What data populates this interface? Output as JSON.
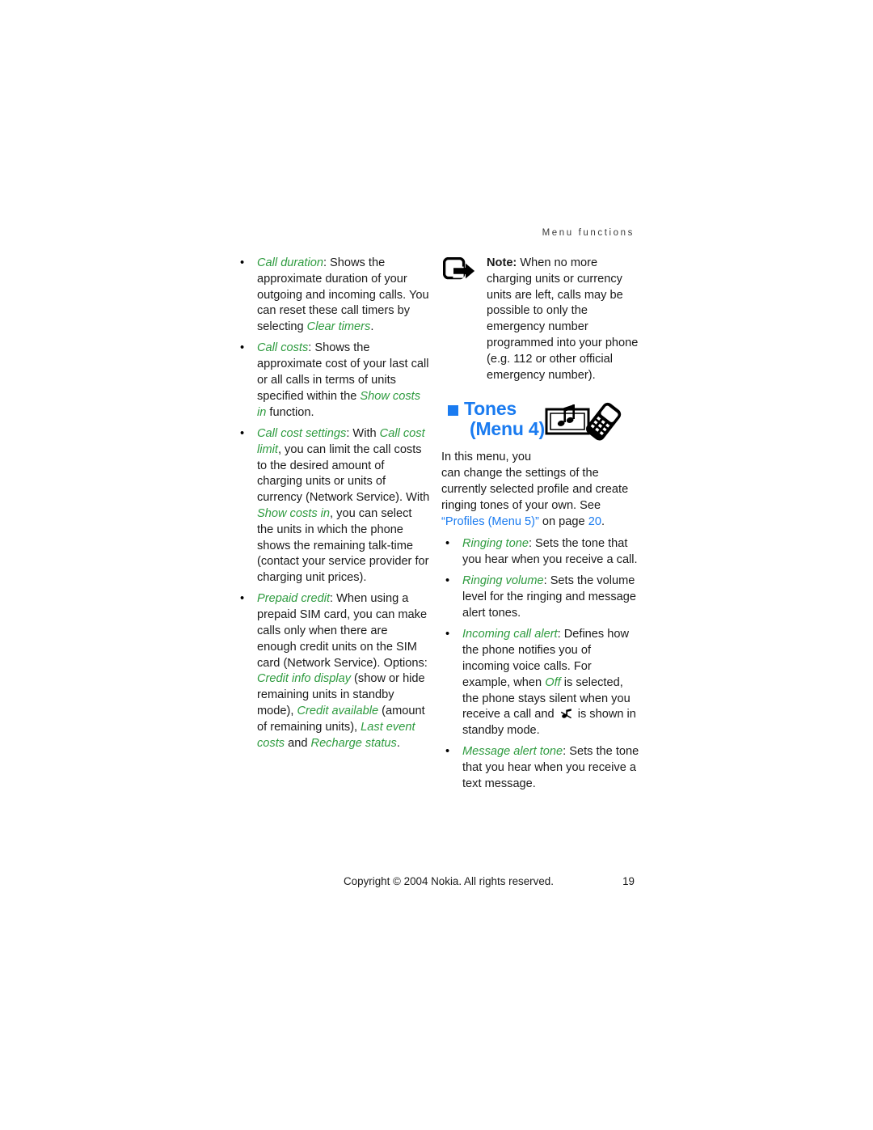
{
  "header": {
    "running_head": "Menu functions"
  },
  "left_column": {
    "bullets": [
      {
        "term": "Call duration",
        "segments": [
          {
            "text": "Call duration",
            "style": "term"
          },
          {
            "text": ": Shows the approximate duration of your outgoing and incoming calls. You can reset these call timers by selecting ",
            "style": "plain"
          },
          {
            "text": "Clear timers",
            "style": "term"
          },
          {
            "text": ".",
            "style": "plain"
          }
        ]
      },
      {
        "term": "Call costs",
        "segments": [
          {
            "text": "Call costs",
            "style": "term"
          },
          {
            "text": ": Shows the approximate cost of your last call or all calls in terms of units specified within the ",
            "style": "plain"
          },
          {
            "text": "Show costs in",
            "style": "term"
          },
          {
            "text": " function.",
            "style": "plain"
          }
        ]
      },
      {
        "term": "Call cost settings",
        "segments": [
          {
            "text": "Call cost settings",
            "style": "term"
          },
          {
            "text": ": With ",
            "style": "plain"
          },
          {
            "text": "Call cost limit",
            "style": "term"
          },
          {
            "text": ", you can limit the call costs to the desired amount of charging units or units of currency (Network Service). With ",
            "style": "plain"
          },
          {
            "text": "Show costs in",
            "style": "term"
          },
          {
            "text": ", you can select the units in which the phone shows the remaining talk-time (contact your service provider for charging unit prices).",
            "style": "plain"
          }
        ]
      },
      {
        "term": "Prepaid credit",
        "segments": [
          {
            "text": "Prepaid credit",
            "style": "term"
          },
          {
            "text": ": When using a prepaid SIM card, you can make calls only when there are enough credit units on the SIM card (Network Service). Options: ",
            "style": "plain"
          },
          {
            "text": "Credit info display",
            "style": "term"
          },
          {
            "text": " (show or hide remaining units in standby mode), ",
            "style": "plain"
          },
          {
            "text": "Credit available",
            "style": "term"
          },
          {
            "text": " (amount of remaining units), ",
            "style": "plain"
          },
          {
            "text": "Last event costs",
            "style": "term"
          },
          {
            "text": " and ",
            "style": "plain"
          },
          {
            "text": "Recharge status",
            "style": "term"
          },
          {
            "text": ".",
            "style": "plain"
          }
        ]
      }
    ],
    "bullet_char": "•"
  },
  "right_column": {
    "note": {
      "icon_name": "note-arrow-icon",
      "label": "Note:",
      "body": " When no more charging units or currency units are left, calls may be possible to only the emergency number programmed into your phone (e.g. 112 or other official emergency number)."
    },
    "chapter": {
      "title": "Tones",
      "subtitle": "(Menu 4)",
      "icon_name": "music-note-phone-icon",
      "square_color": "#1a7bf0",
      "title_color": "#1a7bf0",
      "intro_first_line": "In this menu, you",
      "intro_segments": [
        {
          "text": "can change the settings of the currently selected profile and create ringing tones of your own. See ",
          "style": "plain"
        },
        {
          "text": "“Profiles (Menu 5)”",
          "style": "xref"
        },
        {
          "text": " on page ",
          "style": "plain"
        },
        {
          "text": "20",
          "style": "xref"
        },
        {
          "text": ".",
          "style": "plain"
        }
      ]
    },
    "bullets": [
      {
        "term": "Ringing tone",
        "segments": [
          {
            "text": "Ringing tone",
            "style": "term"
          },
          {
            "text": ": Sets the tone that you hear when you receive a call.",
            "style": "plain"
          }
        ]
      },
      {
        "term": "Ringing volume",
        "segments": [
          {
            "text": "Ringing volume",
            "style": "term"
          },
          {
            "text": ": Sets the volume level for the ringing and message alert tones.",
            "style": "plain"
          }
        ]
      },
      {
        "term": "Incoming call alert",
        "segments": [
          {
            "text": "Incoming call alert",
            "style": "term"
          },
          {
            "text": ": Defines how the phone notifies you of incoming voice calls. For example, when ",
            "style": "plain"
          },
          {
            "text": "Off",
            "style": "term"
          },
          {
            "text": " is selected, the phone stays silent when you receive a call and ",
            "style": "plain"
          },
          {
            "text": "",
            "style": "glyph",
            "glyph_name": "silent-mode-icon"
          },
          {
            "text": " is shown in standby mode.",
            "style": "plain"
          }
        ]
      },
      {
        "term": "Message alert tone",
        "segments": [
          {
            "text": "Message alert tone",
            "style": "term"
          },
          {
            "text": ": Sets the tone that you hear when you receive a text message.",
            "style": "plain"
          }
        ]
      }
    ],
    "bullet_char": "•"
  },
  "footer": {
    "copyright": "Copyright © 2004 Nokia. All rights reserved.",
    "page_number": "19"
  },
  "colors": {
    "link_blue": "#1a7bf0",
    "term_green": "#2e9b3f",
    "body_black": "#1a1a1a",
    "header_gray": "#3a3a3a"
  }
}
